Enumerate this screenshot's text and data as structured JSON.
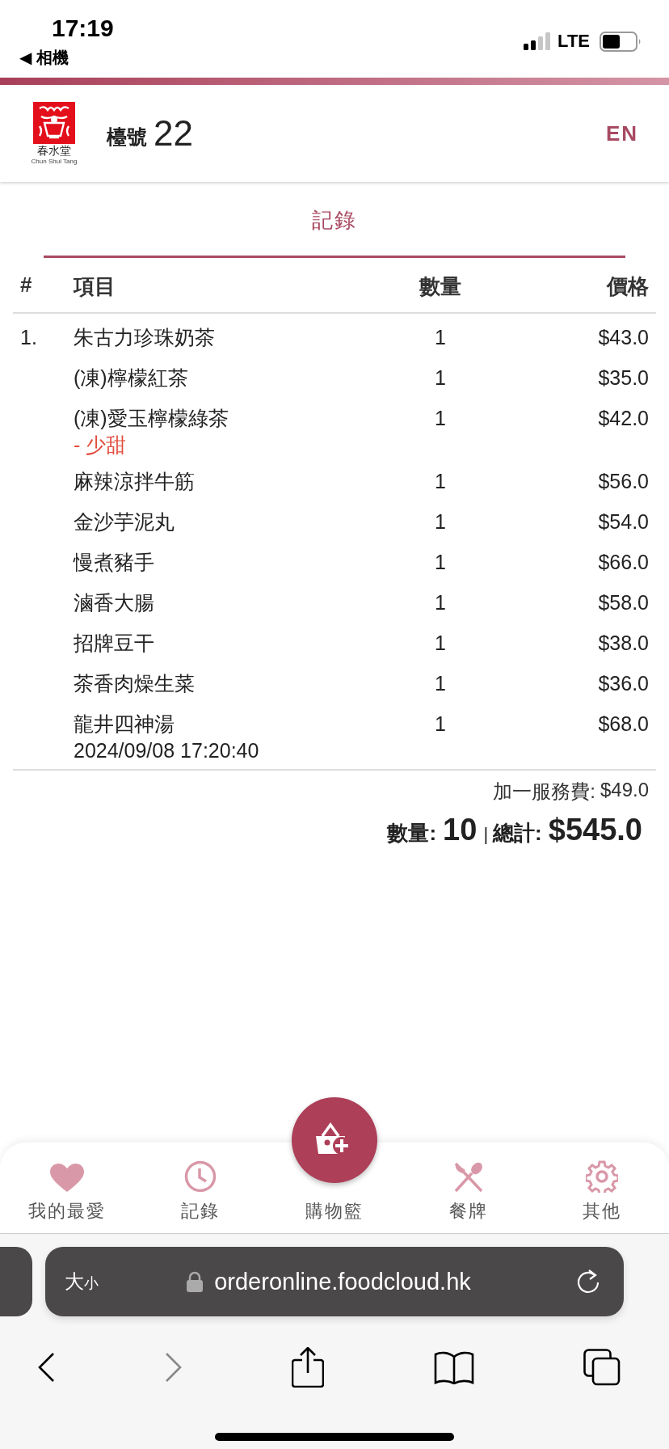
{
  "status_bar": {
    "time": "17:19",
    "back_label": "◀ 相機",
    "network": "LTE"
  },
  "header": {
    "logo": {
      "name_zh": "春水堂",
      "name_en": "Chun Shui Tang"
    },
    "table_label": "檯號",
    "table_number": "22",
    "language": "EN"
  },
  "tabs": [
    {
      "label": "記錄",
      "selected": true
    }
  ],
  "table": {
    "columns": [
      "#",
      "項目",
      "數量",
      "價格"
    ],
    "orders": [
      {
        "index": "1.",
        "time": "2024/09/08 17:20:40",
        "items": [
          {
            "name": "朱古力珍珠奶茶",
            "qty": "1",
            "price": "$43.0"
          },
          {
            "name": "(凍)檸檬紅茶",
            "qty": "1",
            "price": "$35.0"
          },
          {
            "name": "(凍)愛玉檸檬綠茶",
            "qty": "1",
            "price": "$42.0",
            "note": "- 少甜"
          },
          {
            "name": "麻辣涼拌牛筋",
            "qty": "1",
            "price": "$56.0"
          },
          {
            "name": "金沙芋泥丸",
            "qty": "1",
            "price": "$54.0"
          },
          {
            "name": "慢煮豬手",
            "qty": "1",
            "price": "$66.0"
          },
          {
            "name": "滷香大腸",
            "qty": "1",
            "price": "$58.0"
          },
          {
            "name": "招牌豆干",
            "qty": "1",
            "price": "$38.0"
          },
          {
            "name": "茶香肉燥生菜",
            "qty": "1",
            "price": "$36.0"
          },
          {
            "name": "龍井四神湯",
            "qty": "1",
            "price": "$68.0"
          }
        ]
      }
    ]
  },
  "summary": {
    "service_charge_label": "加一服務費:",
    "service_charge": "$49.0",
    "qty_label": "數量:",
    "qty": "10",
    "separator": "|",
    "total_label": "總計:",
    "total": "$545.0"
  },
  "bottom_nav": [
    {
      "label": "我的最愛",
      "kind": "heart"
    },
    {
      "label": "記錄",
      "kind": "clock"
    },
    {
      "label": "購物籃",
      "kind": "cart"
    },
    {
      "label": "餐牌",
      "kind": "utensils"
    },
    {
      "label": "其他",
      "kind": "gear"
    }
  ],
  "browser": {
    "text_size": {
      "large": "大",
      "small": "小"
    },
    "url": "orderonline.foodcloud.hk"
  }
}
